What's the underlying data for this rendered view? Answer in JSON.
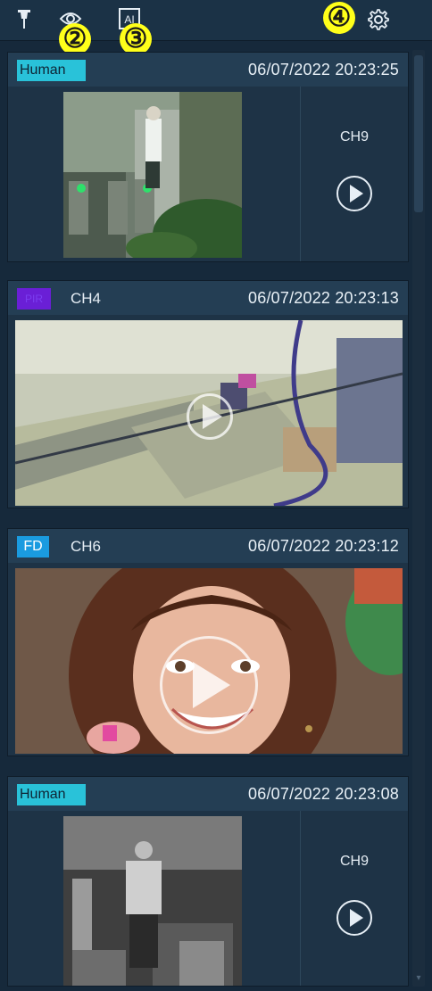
{
  "toolbar": {
    "icons": [
      "pin-icon",
      "eye-icon",
      "ai-icon",
      "gear-icon"
    ],
    "ai_label": "AI",
    "callouts": [
      "②",
      "③",
      "④"
    ]
  },
  "cards": [
    {
      "tag": "Human",
      "tag_color": "#29c2d9",
      "timestamp": "06/07/2022 20:23:25",
      "channel": "CH9",
      "layout": "split"
    },
    {
      "tag": "PIR",
      "tag_color": "#6a1fd6",
      "channel": "CH4",
      "timestamp": "06/07/2022 20:23:13",
      "layout": "full"
    },
    {
      "tag": "FD",
      "tag_color": "#1a9be0",
      "channel": "CH6",
      "timestamp": "06/07/2022 20:23:12",
      "layout": "full"
    },
    {
      "tag": "Human",
      "tag_color": "#29c2d9",
      "timestamp": "06/07/2022 20:23:08",
      "channel": "CH9",
      "layout": "split"
    }
  ],
  "colors": {
    "background": "#16293b",
    "header": "#243e54",
    "callout": "#ffff1a"
  }
}
